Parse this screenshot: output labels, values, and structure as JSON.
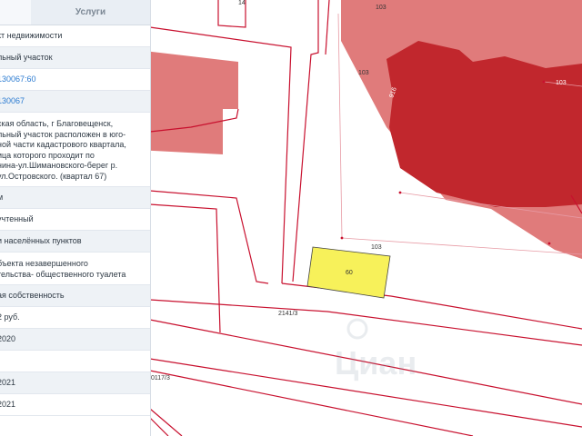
{
  "panel": {
    "tabs": {
      "info": "",
      "services": "Услуги"
    },
    "rows": [
      {
        "name": "row-object-type",
        "lines": [
          "кт недвижимости"
        ]
      },
      {
        "name": "row-object-kind",
        "lines": [
          "льный участок"
        ]
      },
      {
        "name": "row-cadastral-number",
        "lines": [
          "130067:60"
        ],
        "link": true
      },
      {
        "name": "row-cadastral-quarter",
        "lines": [
          "130067"
        ],
        "link": true
      },
      {
        "name": "row-address",
        "lines": [
          "ская область, г Благовещенск,",
          "льный участок расположен в юго-",
          "ной части кадастрового квартала,",
          "ица которого проходит по",
          "нина-ул.Шимановского-берег р.",
          "ул.Островского. (квартал 67)"
        ]
      },
      {
        "name": "row-area",
        "lines": [
          "м"
        ]
      },
      {
        "name": "row-status",
        "lines": [
          " учтенный"
        ]
      },
      {
        "name": "row-land-category",
        "lines": [
          "и населённых пунктов"
        ]
      },
      {
        "name": "row-permitted-use",
        "lines": [
          "бъекта незавершенного",
          "тельства- общественного туалета"
        ]
      },
      {
        "name": "row-ownership",
        "lines": [
          "ая собственность"
        ]
      },
      {
        "name": "row-cadastral-value",
        "lines": [
          "2 руб."
        ]
      },
      {
        "name": "row-value-date",
        "lines": [
          "2020"
        ]
      },
      {
        "name": "row-empty",
        "lines": [
          ""
        ]
      },
      {
        "name": "row-registration-date",
        "lines": [
          "2021"
        ]
      },
      {
        "name": "row-update-date",
        "lines": [
          "2021"
        ]
      }
    ]
  },
  "map": {
    "labels": {
      "parcel_selected": "60",
      "parcel_103_top": "103",
      "parcel_103_left": "103",
      "parcel_103_right": "103",
      "parcel_103_bottom": "103",
      "parcel_14a": "14",
      "parcel_2141": "2141/3",
      "parcel_0117": "0117/3",
      "building_vertical": "916"
    },
    "watermark": "Циан",
    "colors": {
      "parcel_border": "#c8102e",
      "building_light": "#e07b7b",
      "building_dark": "#c1272d",
      "selected_fill": "#f7f15a"
    }
  }
}
